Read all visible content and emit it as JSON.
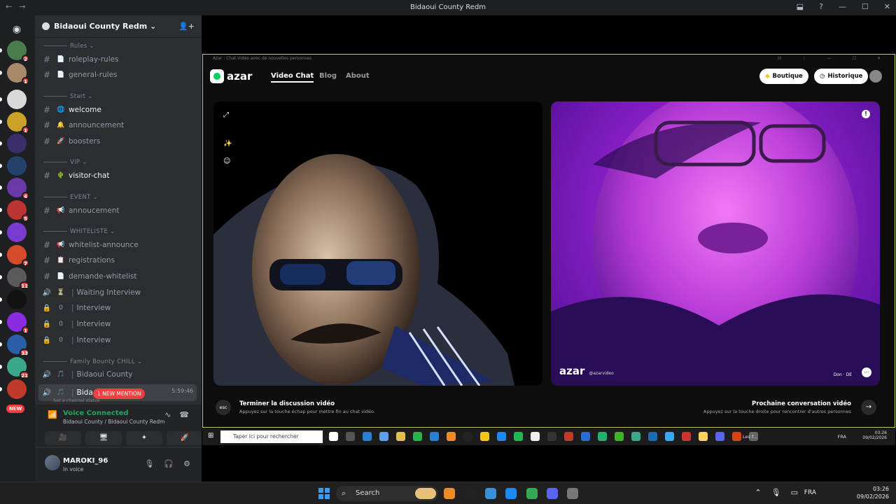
{
  "window": {
    "title": "Bidaoui County Redm",
    "nav_back": "←",
    "nav_forward": "→",
    "controls": [
      "⬓",
      "?",
      "—",
      "☐",
      "✕"
    ]
  },
  "guilds": [
    {
      "name": "server-1",
      "badge": "2",
      "color": "#4a7c4e"
    },
    {
      "name": "server-2",
      "badge": "1",
      "color": "#a88a6a"
    },
    {
      "name": "server-3",
      "badge": "",
      "color": "#d9d9d9"
    },
    {
      "name": "server-bidaoui",
      "badge": "1",
      "color": "#c9a227"
    },
    {
      "name": "server-5",
      "badge": "",
      "color": "#3a2e6b"
    },
    {
      "name": "server-6",
      "badge": "",
      "color": "#24426b"
    },
    {
      "name": "server-7",
      "badge": "4",
      "color": "#6a3aa8"
    },
    {
      "name": "server-8",
      "badge": "5",
      "color": "#b33"
    },
    {
      "name": "server-9",
      "badge": "",
      "color": "#7a3bd1"
    },
    {
      "name": "server-10",
      "badge": "7",
      "color": "#d64b2a"
    },
    {
      "name": "server-11",
      "badge": "11",
      "color": "#5a5a5a"
    },
    {
      "name": "server-12",
      "badge": "",
      "color": "#111111"
    },
    {
      "name": "server-13",
      "badge": "1",
      "color": "#8a2be2"
    },
    {
      "name": "server-14",
      "badge": "33",
      "color": "#2a5fa8"
    },
    {
      "name": "server-15",
      "badge": "21",
      "color": "#3aa88a"
    },
    {
      "name": "server-16",
      "badge": "",
      "color": "#c0392b"
    }
  ],
  "new_badge": "NEW",
  "server": {
    "name": "Bidaoui County Redm ⌄",
    "invite_icon": "👤+"
  },
  "categories": [
    {
      "label": "Rules ⌄"
    },
    {
      "label": "Start ⌄"
    },
    {
      "label": "VIP ⌄"
    },
    {
      "label": "EVENT ⌄"
    },
    {
      "label": "WHITELISTE ⌄"
    },
    {
      "label": "Family Bounty CHILL ⌄"
    }
  ],
  "channels": [
    {
      "prefix": "#",
      "emoji": "📄",
      "name": "roleplay-rules"
    },
    {
      "prefix": "#",
      "emoji": "📄",
      "name": "general-rules"
    },
    {
      "prefix": "#",
      "emoji": "🌐",
      "name": "welcome"
    },
    {
      "prefix": "#",
      "emoji": "🔔",
      "name": "announcement"
    },
    {
      "prefix": "#",
      "emoji": "🚀",
      "name": "boosters"
    },
    {
      "prefix": "#",
      "emoji": "🌵",
      "name": "visitor-chat"
    },
    {
      "prefix": "#",
      "emoji": "📢",
      "name": "annoucement"
    },
    {
      "prefix": "#",
      "emoji": "📢",
      "name": "whitelist-announce"
    },
    {
      "prefix": "#",
      "emoji": "📋",
      "name": "registrations"
    },
    {
      "prefix": "#",
      "emoji": "📄",
      "name": "demande-whitelist"
    },
    {
      "prefix": "🔊",
      "emoji": "⏳",
      "name": "Waiting Interview"
    },
    {
      "prefix": "🔒",
      "emoji": "0",
      "name": "Interview"
    },
    {
      "prefix": "🔒",
      "emoji": "0",
      "name": "Interview"
    },
    {
      "prefix": "🔒",
      "emoji": "0",
      "name": "Interview"
    },
    {
      "prefix": "🔊",
      "emoji": "🎵",
      "name": "Bidaoui County"
    },
    {
      "prefix": "🔊",
      "emoji": "🎵",
      "name": "Bida"
    }
  ],
  "voice_timer": "5:59:46",
  "mention_label": "1 NEW MENTION",
  "status_hint": "Set a channel status",
  "voice": {
    "status": "Voice Connected",
    "location": "Bidaoui County / Bidaoui County Redm",
    "signal_icon": "📶",
    "noise_icon": "∿",
    "disconnect_icon": "☎",
    "buttons": [
      "🎥",
      "🖥",
      "✦",
      "🚀"
    ]
  },
  "user": {
    "name": "MAROKI_96",
    "status": "In voice",
    "mic_icon": "🎙",
    "headset_icon": "🎧",
    "settings_icon": "⚙"
  },
  "azar": {
    "window_title": "Azar : Chat Vidéo avec de nouvelles personnes",
    "window_controls": "⊡ ⋮ — ☐ ✕",
    "logo": "azar",
    "nav": {
      "video_chat": "Video Chat",
      "blog": "Blog",
      "about": "About"
    },
    "boutique": "Boutique",
    "historique": "Historique",
    "left_icons": [
      "⤢",
      "✨",
      "☺"
    ],
    "report": "!",
    "watermark": "azar",
    "watermark_handle": "@azarvideo",
    "peer": "Don · DE",
    "peer_more": "···",
    "esc": "esc",
    "end_title": "Terminer la discussion vidéo",
    "end_hint": "Appuyez sur la touche échap pour mettre fin au chat vidéo.",
    "next_title": "Prochaine conversation vidéo",
    "next_hint": "Appuyez sur la touche droite pour rencontrer d'autres personnes",
    "next_arrow": "→"
  },
  "inner_taskbar": {
    "start": "⊞",
    "search_placeholder": "Taper ici pour rechercher",
    "les_f": "Les f...",
    "lang": "FRA",
    "time": "03:26",
    "date": "09/02/2026"
  },
  "taskbar": {
    "search": "Search",
    "lang": "FRA",
    "time": "03:26",
    "date": "09/02/2026",
    "tray_icons": [
      "⌃",
      "🎙",
      "▭",
      "🔊"
    ]
  }
}
